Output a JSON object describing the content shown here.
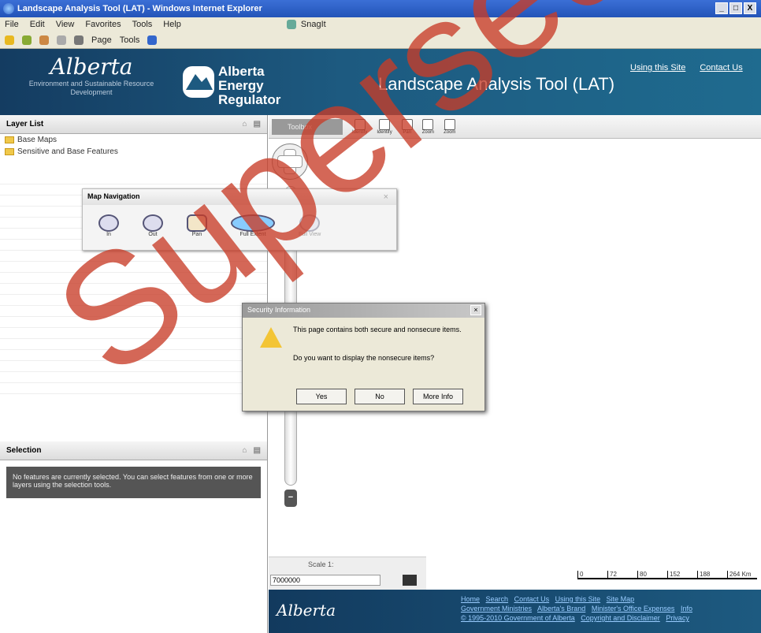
{
  "window": {
    "title": "Landscape Analysis Tool (LAT) - Windows Internet Explorer",
    "buttons": [
      "_",
      "□",
      "X"
    ]
  },
  "menubar": {
    "items": [
      "File",
      "Edit",
      "View",
      "Favorites",
      "Tools",
      "Help"
    ],
    "snagit": "SnagIt"
  },
  "cmdbar": {
    "page": "Page",
    "tools": "Tools"
  },
  "banner": {
    "alberta": "Alberta",
    "dept": "Environment and Sustainable Resource Development",
    "aer": [
      "Alberta",
      "Energy",
      "Regulator"
    ],
    "title": "Landscape Analysis Tool (LAT)",
    "links": [
      "Using this Site",
      "Contact Us"
    ]
  },
  "layer_list": {
    "title": "Layer List",
    "items": [
      "Base Maps",
      "Sensitive and Base Features"
    ]
  },
  "selection": {
    "title": "Selection",
    "message": "No features are currently selected. You can select features from one or more layers using the selection tools."
  },
  "map_toolbar": {
    "box": "Toolbox",
    "tools": [
      "Identify",
      "Identify",
      "Pan",
      "Zoom",
      "Zoom"
    ]
  },
  "map_navigation": {
    "title": "Map Navigation",
    "tools": [
      "In",
      "Out",
      "Pan",
      "Full Extent",
      "Full View"
    ]
  },
  "security_dialog": {
    "title": "Security Information",
    "message": "This page contains both secure and nonsecure items.",
    "question": "Do you want to display the nonsecure items?",
    "buttons": [
      "Yes",
      "No",
      "More Info"
    ]
  },
  "scale": {
    "label": "Scale 1:",
    "value": "7000000",
    "ticks": [
      "0",
      "72",
      "80",
      "152",
      "188",
      "264 Km"
    ]
  },
  "footer": {
    "alberta": "Alberta",
    "row1": [
      "Home",
      "Search",
      "Contact Us",
      "Using this Site",
      "Site Map"
    ],
    "row2": [
      "Government Ministries",
      "Alberta's Brand",
      "Minister's Office Expenses",
      "Info"
    ],
    "row3": [
      "© 1995-2010 Government of Alberta",
      "Copyright and Disclaimer",
      "Privacy"
    ]
  },
  "watermark": "Superseded"
}
